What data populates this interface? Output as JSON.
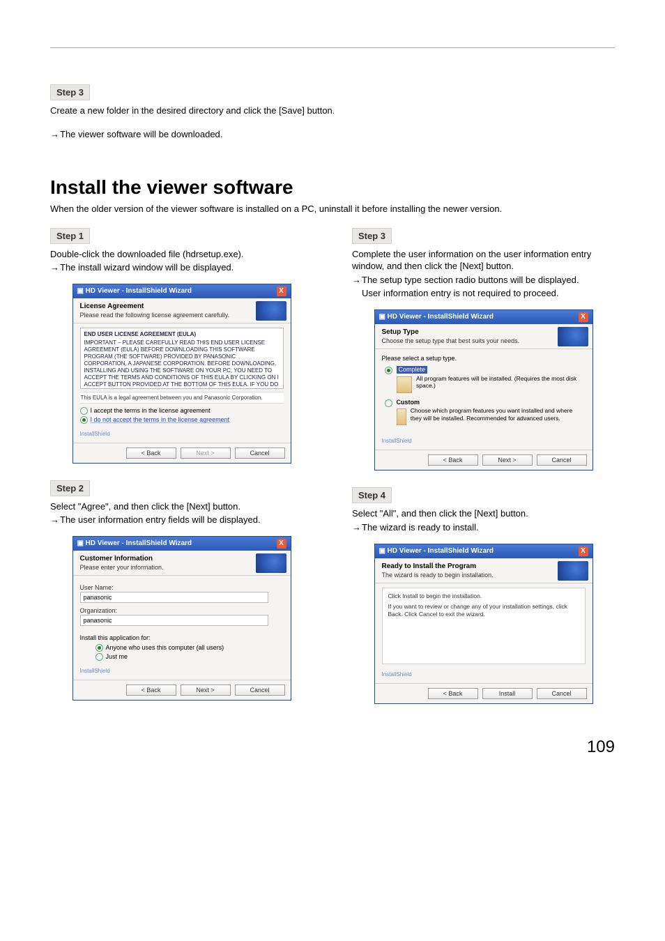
{
  "page_number": "109",
  "pre": {
    "step_label": "Step 3",
    "p1": "Create a new folder in the desired directory and click the [Save] button.",
    "a1": "The viewer software will be downloaded."
  },
  "section_title": "Install the viewer software",
  "section_intro": "When the older version of the viewer software is installed on a PC, uninstall it before installing the newer version.",
  "left": {
    "s1": {
      "label": "Step 1",
      "p": "Double-click the downloaded file (hdrsetup.exe).",
      "a": "The install wizard window will be displayed."
    },
    "s2": {
      "label": "Step 2",
      "p": "Select \"Agree\", and then click the [Next] button.",
      "a": "The user information entry fields will be displayed."
    }
  },
  "right": {
    "s3": {
      "label": "Step 3",
      "p": "Complete the user information on the user information entry window, and then click the [Next] button.",
      "a": "The setup type section radio buttons will be displayed.",
      "a2": "User information entry is not required to proceed."
    },
    "s4": {
      "label": "Step 4",
      "p": "Select \"All\", and then click the [Next] button.",
      "a": "The wizard is ready to install."
    }
  },
  "dlg": {
    "title": "HD Viewer - InstallShield Wizard",
    "close": "X",
    "btn_back": "< Back",
    "btn_next": "Next >",
    "btn_install": "Install",
    "btn_cancel": "Cancel",
    "brand": "InstallShield",
    "license": {
      "h": "License Agreement",
      "sub": "Please read the following license agreement carefully.",
      "eula_h": "END USER LICENSE AGREEMENT (EULA)",
      "eula_body": "IMPORTANT – PLEASE CAREFULLY READ THIS END USER LICENSE AGREEMENT (EULA) BEFORE DOWNLOADING THIS SOFTWARE PROGRAM (THE SOFTWARE) PROVIDED BY PANASONIC CORPORATION, A JAPANESE CORPORATION. BEFORE DOWNLOADING, INSTALLING AND USING THE SOFTWARE ON YOUR PC, YOU NEED TO ACCEPT THE TERMS AND CONDITIONS OF THIS EULA BY CLICKING ON I ACCEPT BUTTON PROVIDED AT THE BOTTOM OF THIS EULA. IF YOU DO NOT AGREE TO THE TERMS AND CONDITIONS OF THIS EULA, YOU MAY NOT DOWNLOAD, INSTALL OR USE THIS SOFTWARE.",
      "eula_foot": "This EULA is a legal agreement between you and Panasonic Corporation.",
      "r1": "I accept the terms in the license agreement",
      "r2": "I do not accept the terms in the license agreement"
    },
    "cust": {
      "h": "Customer Information",
      "sub": "Please enter your information.",
      "l_user": "User Name:",
      "v_user": "panasonic",
      "l_org": "Organization:",
      "v_org": "panasonic",
      "install_for": "Install this application for:",
      "r1": "Anyone who uses this computer (all users)",
      "r2": "Just me"
    },
    "setup": {
      "h": "Setup Type",
      "sub": "Choose the setup type that best suits your needs.",
      "please": "Please select a setup type.",
      "o1_name": "Complete",
      "o1_desc": "All program features will be installed. (Requires the most disk space.)",
      "o2_name": "Custom",
      "o2_desc": "Choose which program features you want installed and where they will be installed. Recommended for advanced users."
    },
    "ready": {
      "h": "Ready to Install the Program",
      "sub": "The wizard is ready to begin installation.",
      "l1": "Click Install to begin the installation.",
      "l2": "If you want to review or change any of your installation settings, click Back. Click Cancel to exit the wizard."
    }
  }
}
